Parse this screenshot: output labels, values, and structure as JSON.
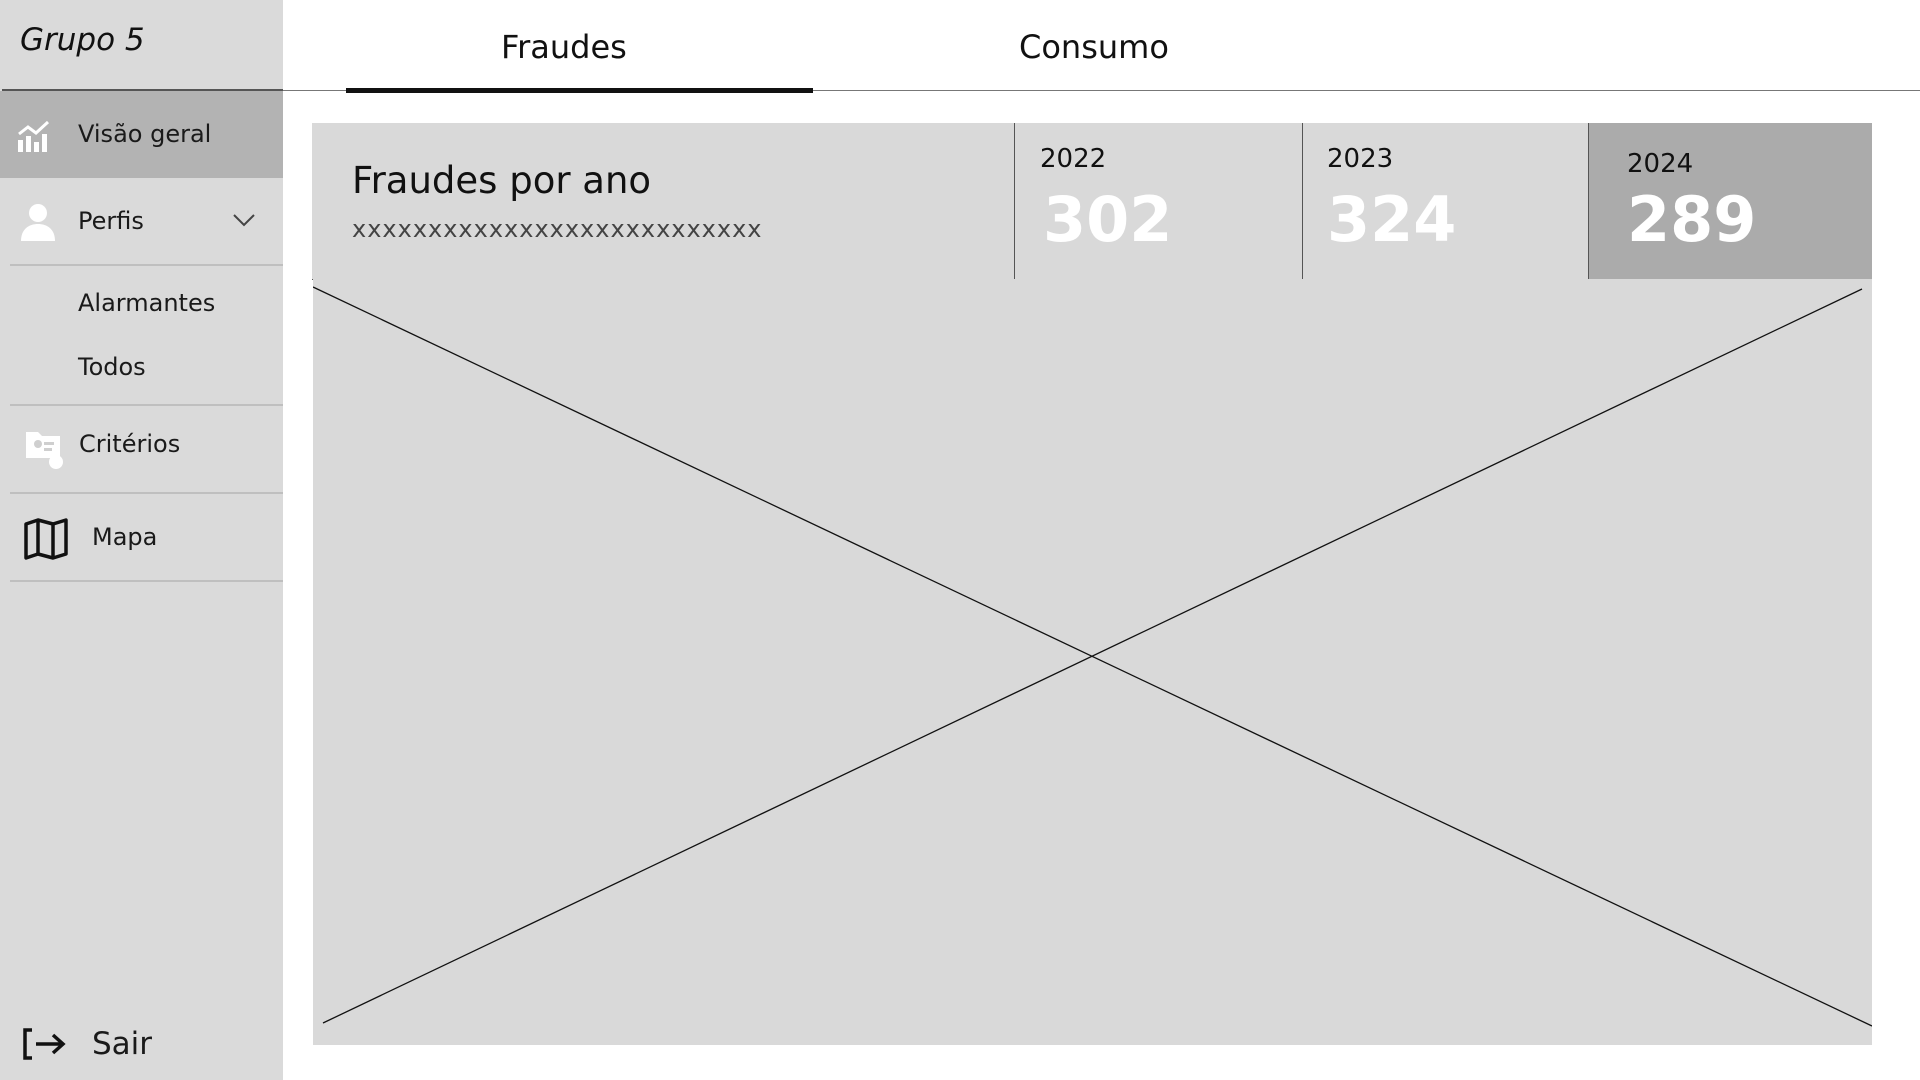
{
  "app": {
    "brand": "Grupo 5"
  },
  "sidebar": {
    "items": [
      {
        "label": "Visão geral",
        "icon": "chart-icon",
        "active": true
      },
      {
        "label": "Perfis",
        "icon": "user-icon"
      },
      {
        "label": "Alarmantes"
      },
      {
        "label": "Todos"
      },
      {
        "label": "Critérios",
        "icon": "criteria-icon"
      },
      {
        "label": "Mapa",
        "icon": "map-icon"
      }
    ],
    "logout": {
      "label": "Sair",
      "icon": "logout-icon"
    }
  },
  "tabs": [
    {
      "label": "Fraudes",
      "active": true
    },
    {
      "label": "Consumo"
    }
  ],
  "stats": {
    "title": "Fraudes por ano",
    "subtitle": "xxxxxxxxxxxxxxxxxxxxxxxxxxx",
    "years": [
      {
        "year": "2022",
        "value": "302"
      },
      {
        "year": "2023",
        "value": "324"
      },
      {
        "year": "2024",
        "value": "289",
        "highlight": true
      }
    ]
  },
  "colors": {
    "sidebar_bg": "#dadada",
    "active_bg": "#b3b3b3",
    "panel_bg": "#d9d9d9",
    "value_text": "#ffffff"
  }
}
